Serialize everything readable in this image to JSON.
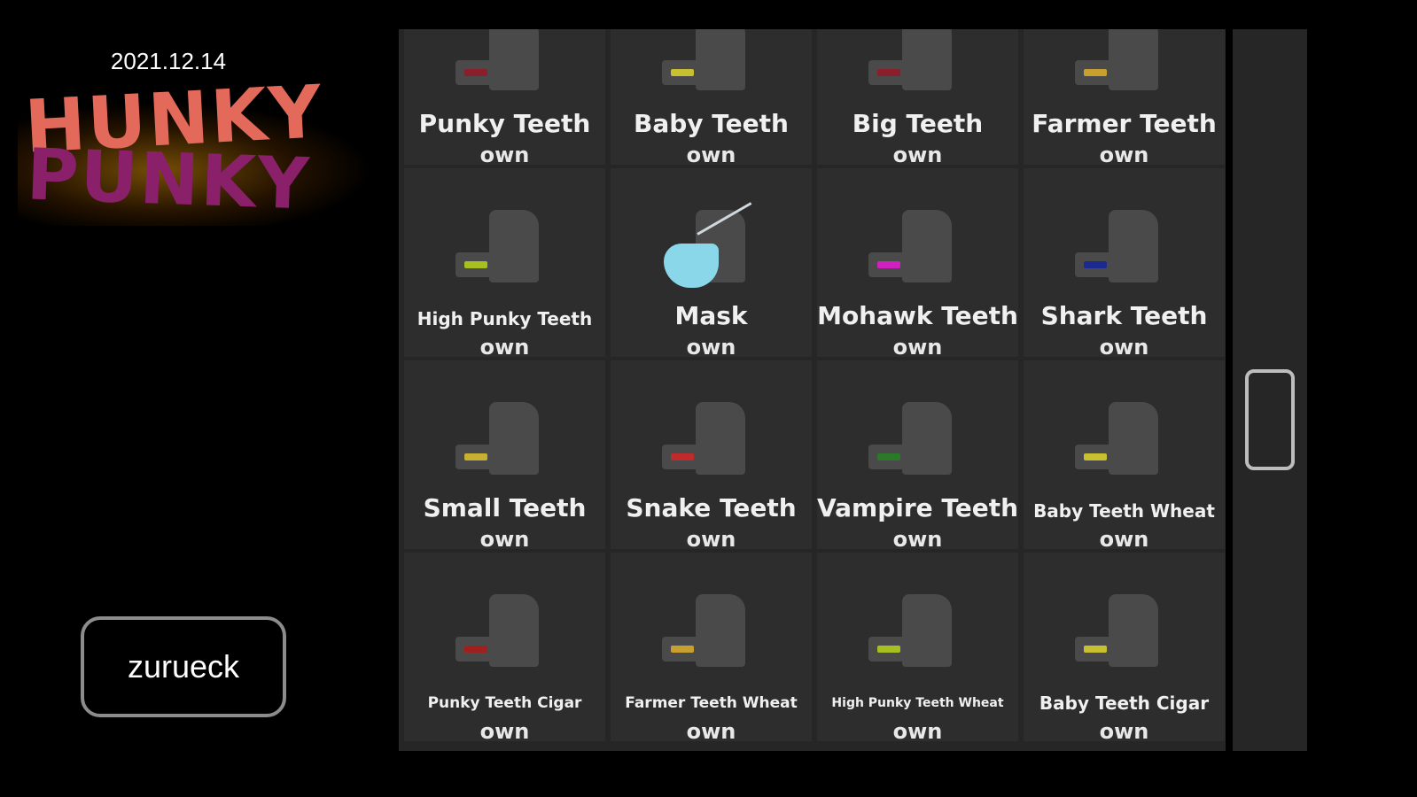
{
  "date": "2021.12.14",
  "logo": {
    "line1": "HUNKY",
    "line2": "PUNKY",
    "colors": {
      "top": "#e36a5a",
      "bottom": "#8a1f6a",
      "glow": "#d28c0a"
    }
  },
  "back_button": {
    "label": "zurueck"
  },
  "items": [
    {
      "name": "Punky Teeth",
      "status": "own",
      "icon": "teeth-punky",
      "color": "#8b1e2b"
    },
    {
      "name": "Baby Teeth",
      "status": "own",
      "icon": "teeth-baby",
      "color": "#c8c030"
    },
    {
      "name": "Big Teeth",
      "status": "own",
      "icon": "teeth-big",
      "color": "#8b1e2b"
    },
    {
      "name": "Farmer Teeth",
      "status": "own",
      "icon": "teeth-farmer",
      "color": "#c8a030"
    },
    {
      "name": "High Punky Teeth",
      "status": "own",
      "icon": "teeth-high-punky",
      "color": "#a7c020"
    },
    {
      "name": "Mask",
      "status": "own",
      "icon": "mask",
      "color": "#8ad7ea"
    },
    {
      "name": "Mohawk Teeth",
      "status": "own",
      "icon": "teeth-mohawk",
      "color": "#d020c0"
    },
    {
      "name": "Shark Teeth",
      "status": "own",
      "icon": "teeth-shark",
      "color": "#1a2a90"
    },
    {
      "name": "Small Teeth",
      "status": "own",
      "icon": "teeth-small",
      "color": "#c8b030"
    },
    {
      "name": "Snake Teeth",
      "status": "own",
      "icon": "teeth-snake",
      "color": "#c02a2a"
    },
    {
      "name": "Vampire Teeth",
      "status": "own",
      "icon": "teeth-vampire",
      "color": "#2a7a2a"
    },
    {
      "name": "Baby Teeth Wheat",
      "status": "own",
      "icon": "teeth-baby-wheat",
      "color": "#c8c030"
    },
    {
      "name": "Punky Teeth Cigar",
      "status": "own",
      "icon": "teeth-punky-cigar",
      "color": "#a02020"
    },
    {
      "name": "Farmer Teeth Wheat",
      "status": "own",
      "icon": "teeth-farmer-wheat",
      "color": "#c8a030"
    },
    {
      "name": "High Punky Teeth Wheat",
      "status": "own",
      "icon": "teeth-high-punky-wheat",
      "color": "#a7c020"
    },
    {
      "name": "Baby Teeth Cigar",
      "status": "own",
      "icon": "teeth-baby-cigar",
      "color": "#c8c030"
    }
  ],
  "scroll": {
    "position": 0.55
  }
}
